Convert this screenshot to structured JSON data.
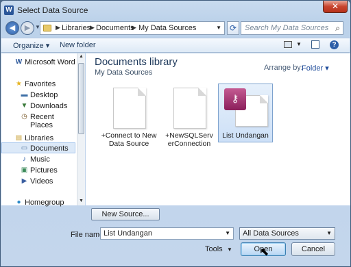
{
  "window": {
    "title": "Select Data Source",
    "app_icon": "W",
    "close": "✕"
  },
  "address": {
    "segments": [
      "Libraries",
      "Documents",
      "My Data Sources"
    ],
    "search_placeholder": "Search My Data Sources"
  },
  "toolbar": {
    "organize": "Organize ▾",
    "new_folder": "New folder",
    "help": "?"
  },
  "nav": {
    "items": [
      {
        "label": "Microsoft Word",
        "icon": "word-icon",
        "glyph": "W",
        "color": "#2a5699"
      },
      {
        "label": "Favorites",
        "icon": "star-icon",
        "glyph": "★",
        "color": "#e6b422"
      },
      {
        "label": "Desktop",
        "icon": "desktop-icon",
        "glyph": "▬",
        "color": "#3b6ea5"
      },
      {
        "label": "Downloads",
        "icon": "downloads-icon",
        "glyph": "▼",
        "color": "#3a7a3a"
      },
      {
        "label": "Recent Places",
        "icon": "recent-places-icon",
        "glyph": "◷",
        "color": "#7a5a2a"
      },
      {
        "label": "Libraries",
        "icon": "libraries-icon",
        "glyph": "▤",
        "color": "#c9a23a"
      },
      {
        "label": "Documents",
        "icon": "documents-icon",
        "glyph": "▭",
        "color": "#5a7aa0",
        "selected": true
      },
      {
        "label": "Music",
        "icon": "music-icon",
        "glyph": "♪",
        "color": "#2d5fa8"
      },
      {
        "label": "Pictures",
        "icon": "pictures-icon",
        "glyph": "▣",
        "color": "#3b8a5a"
      },
      {
        "label": "Videos",
        "icon": "videos-icon",
        "glyph": "▶",
        "color": "#3b5fa0"
      },
      {
        "label": "Homegroup",
        "icon": "homegroup-icon",
        "glyph": "●",
        "color": "#2d8ac8"
      }
    ]
  },
  "main": {
    "library_title": "Documents library",
    "library_subtitle": "My Data Sources",
    "arrange_label": "Arrange by:",
    "arrange_value": "Folder ▾",
    "files": [
      {
        "name": "+Connect to New Data Source",
        "type": "odc"
      },
      {
        "name": "+NewSQLServerConnection",
        "type": "odc"
      },
      {
        "name": "List Undangan",
        "type": "access",
        "selected": true
      }
    ]
  },
  "bottom": {
    "new_source": "New Source...",
    "file_name_label": "File name:",
    "file_name_value": "List Undangan",
    "filter_value": "All Data Sources",
    "tools": "Tools",
    "open": "Open",
    "cancel": "Cancel"
  }
}
